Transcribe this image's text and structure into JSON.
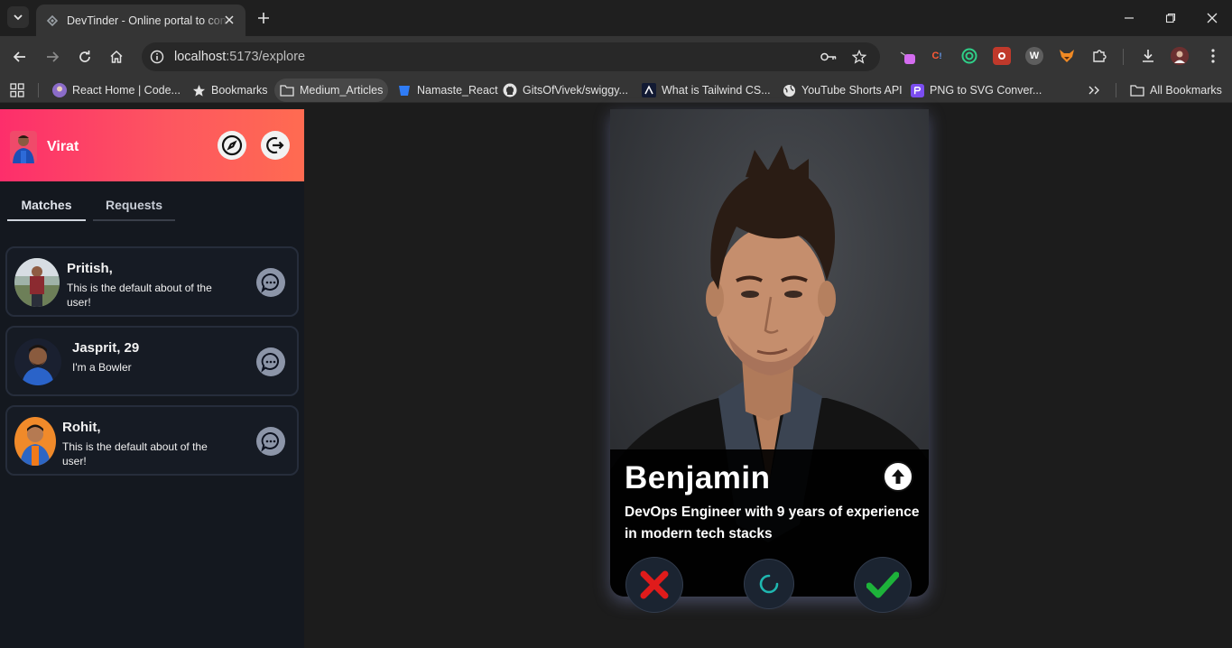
{
  "browser": {
    "tab_title": "DevTinder - Online portal to connect developers",
    "url_host": "localhost",
    "url_rest": ":5173/explore",
    "bookmarks": [
      "React Home | Code...",
      "Bookmarks",
      "Medium_Articles",
      "Namaste_React",
      "GitsOfVivek/swiggy...",
      "What is Tailwind CS...",
      "YouTube Shorts API",
      "PNG to SVG Conver..."
    ],
    "all_bookmarks": "All Bookmarks"
  },
  "sidebar": {
    "user_name": "Virat",
    "tabs": [
      "Matches",
      "Requests"
    ],
    "matches": [
      {
        "name": "Pritish,",
        "about": "This is the default about of the user!"
      },
      {
        "name": "Jasprit, 29",
        "about": "I'm a Bowler"
      },
      {
        "name": "Rohit,",
        "about": "This is the default about of the user!"
      }
    ]
  },
  "card": {
    "name": "Benjamin",
    "about": "DevOps Engineer with 9 years of experience in modern tech stacks"
  },
  "colors": {
    "header_gradient_start": "#fd2e6b",
    "header_gradient_end": "#ff6b51",
    "reject": "#e01b1b",
    "accept": "#1db33a",
    "reload": "#1fb7b0"
  }
}
